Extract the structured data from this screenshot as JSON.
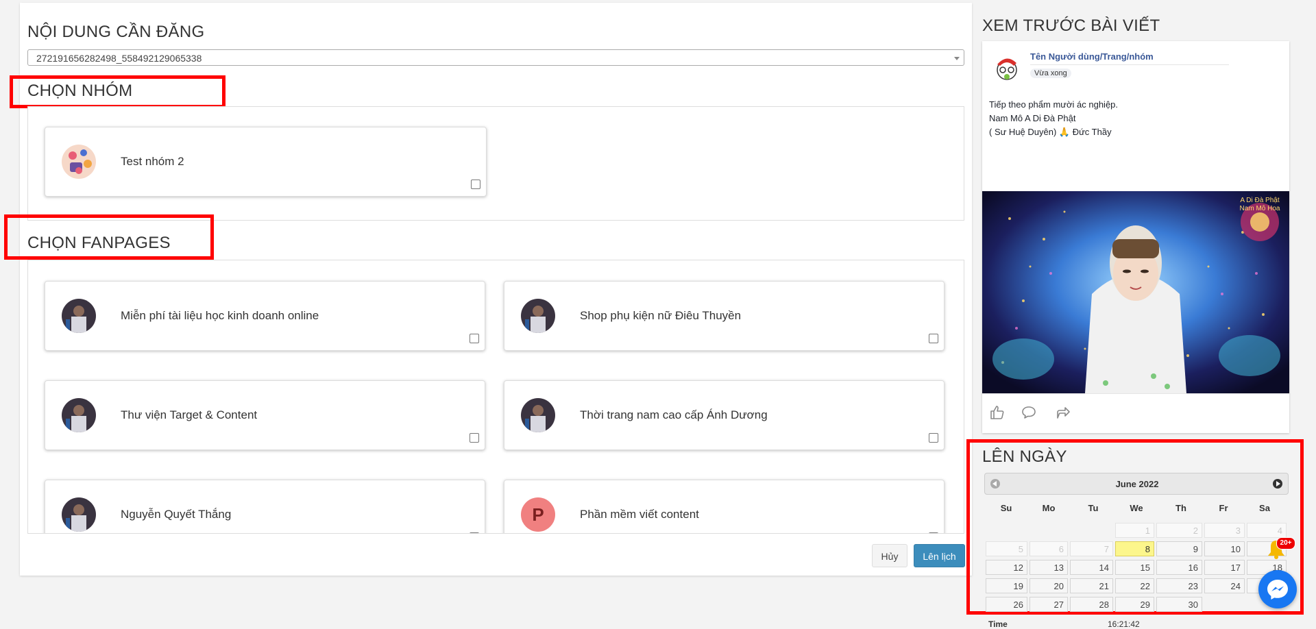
{
  "left": {
    "content_title": "NỘI DUNG CẦN ĐĂNG",
    "content_select_value": "272191656282498_558492129065338",
    "group_title": "CHỌN NHÓM",
    "groups": [
      {
        "name": "Test nhóm 2"
      }
    ],
    "fanpage_title": "CHỌN FANPAGES",
    "fanpages": [
      {
        "name": "Miễn phí tài liệu học kinh doanh online"
      },
      {
        "name": "Shop phụ kiện nữ Điêu Thuyền"
      },
      {
        "name": "Thư viện Target & Content"
      },
      {
        "name": "Thời trang nam cao cấp Ánh Dương"
      },
      {
        "name": "Nguyễn Quyết Thắng"
      },
      {
        "name": "Phần mềm viết content",
        "initial": "P"
      }
    ],
    "cancel_label": "Hủy",
    "schedule_label": "Lên lịch"
  },
  "preview": {
    "title": "XEM TRƯỚC BÀI VIẾT",
    "author": "Tên Người dùng/Trang/nhóm",
    "time": "Vừa xong",
    "line1": "Tiếp theo phẩm mười ác nghiệp.",
    "line2": "Nam Mô A Di Đà Phật",
    "line3": "( Sư Huệ Duyên) 🙏 Đức Thầy",
    "image_text": "A Di Đà Phật Nam Mô Hoa"
  },
  "schedule": {
    "title": "LÊN NGÀY",
    "month": "June 2022",
    "weekdays": [
      "Su",
      "Mo",
      "Tu",
      "We",
      "Th",
      "Fr",
      "Sa"
    ],
    "row0": [
      "",
      "",
      "",
      "1",
      "2",
      "3",
      "4"
    ],
    "row1": [
      "5",
      "6",
      "7",
      "8",
      "9",
      "10",
      "11"
    ],
    "row2": [
      "12",
      "13",
      "14",
      "15",
      "16",
      "17",
      "18"
    ],
    "row3": [
      "19",
      "20",
      "21",
      "22",
      "23",
      "24",
      "25"
    ],
    "row4": [
      "26",
      "27",
      "28",
      "29",
      "30",
      "",
      ""
    ],
    "time_label": "Time",
    "time_value": "16:21:42",
    "notification_count": "20+"
  },
  "colors": {
    "accent": "#337ab7",
    "highlight": "#f00",
    "link": "#3b5998"
  }
}
